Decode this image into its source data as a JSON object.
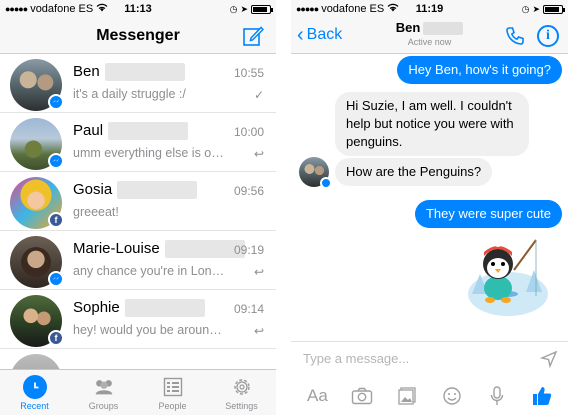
{
  "status": {
    "carrier": "vodafone ES",
    "time_left": "11:13",
    "time_right": "11:19"
  },
  "inbox": {
    "title": "Messenger",
    "conversations": [
      {
        "name": "Ben",
        "time": "10:55",
        "preview": "it's a daily struggle :/",
        "status_icon": "check-icon",
        "badge": "messenger"
      },
      {
        "name": "Paul",
        "time": "10:00",
        "preview": "umm everything else is o…",
        "status_icon": "reply-icon",
        "badge": "messenger"
      },
      {
        "name": "Gosia",
        "time": "09:56",
        "preview": "greeeat!",
        "status_icon": "",
        "badge": "facebook"
      },
      {
        "name": "Marie-Louise",
        "time": "09:19",
        "preview": "any chance you're in Lon…",
        "status_icon": "reply-icon",
        "badge": "messenger"
      },
      {
        "name": "Sophie",
        "time": "09:14",
        "preview": "hey! would you be aroun…",
        "status_icon": "reply-icon",
        "badge": "facebook"
      }
    ],
    "tabs": [
      {
        "label": "Recent",
        "icon": "clock-icon",
        "active": true
      },
      {
        "label": "Groups",
        "icon": "groups-icon",
        "active": false
      },
      {
        "label": "People",
        "icon": "people-list-icon",
        "active": false
      },
      {
        "label": "Settings",
        "icon": "gear-icon",
        "active": false
      }
    ]
  },
  "chat": {
    "back_label": "Back",
    "contact_name": "Ben",
    "contact_status": "Active now",
    "messages": [
      {
        "direction": "out",
        "text": "Hey Ben, how's it going?"
      },
      {
        "direction": "in",
        "text": "Hi Suzie, I am well. I couldn't help but notice you were with penguins."
      },
      {
        "direction": "in",
        "text": "How are the Penguins?"
      },
      {
        "direction": "out",
        "text": "They were super cute"
      }
    ],
    "sticker": "penguin-ice-fishing-sticker",
    "input_placeholder": "Type a message...",
    "text_format_label": "Aa",
    "toolbar_icons": [
      "text-format-icon",
      "camera-icon",
      "gallery-icon",
      "emoji-icon",
      "microphone-icon",
      "like-icon"
    ]
  },
  "colors": {
    "accent": "#0084ff",
    "outgoing_bubble": "#0084ff",
    "incoming_bubble": "#f0f0f0",
    "facebook_badge": "#3b5998"
  }
}
